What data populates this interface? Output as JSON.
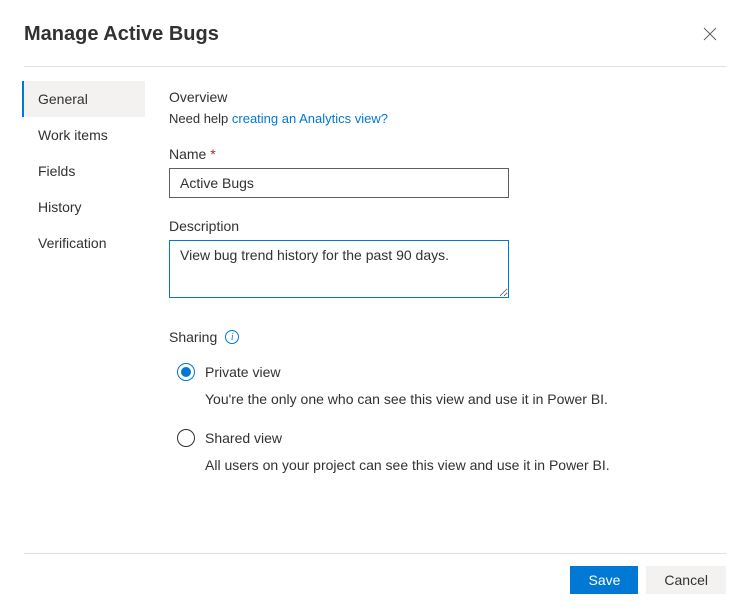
{
  "header": {
    "title": "Manage Active Bugs"
  },
  "sidebar": {
    "items": [
      {
        "label": "General",
        "active": true
      },
      {
        "label": "Work items",
        "active": false
      },
      {
        "label": "Fields",
        "active": false
      },
      {
        "label": "History",
        "active": false
      },
      {
        "label": "Verification",
        "active": false
      }
    ]
  },
  "overview": {
    "heading": "Overview",
    "help_prefix": "Need help ",
    "help_link": "creating an Analytics view?",
    "name_label": "Name",
    "name_value": "Active Bugs",
    "description_label": "Description",
    "description_value": "View bug trend history for the past 90 days."
  },
  "sharing": {
    "heading": "Sharing",
    "options": [
      {
        "label": "Private view",
        "description": "You're the only one who can see this view and use it in Power BI.",
        "selected": true
      },
      {
        "label": "Shared view",
        "description": "All users on your project can see this view and use it in Power BI.",
        "selected": false
      }
    ]
  },
  "footer": {
    "save_label": "Save",
    "cancel_label": "Cancel"
  }
}
